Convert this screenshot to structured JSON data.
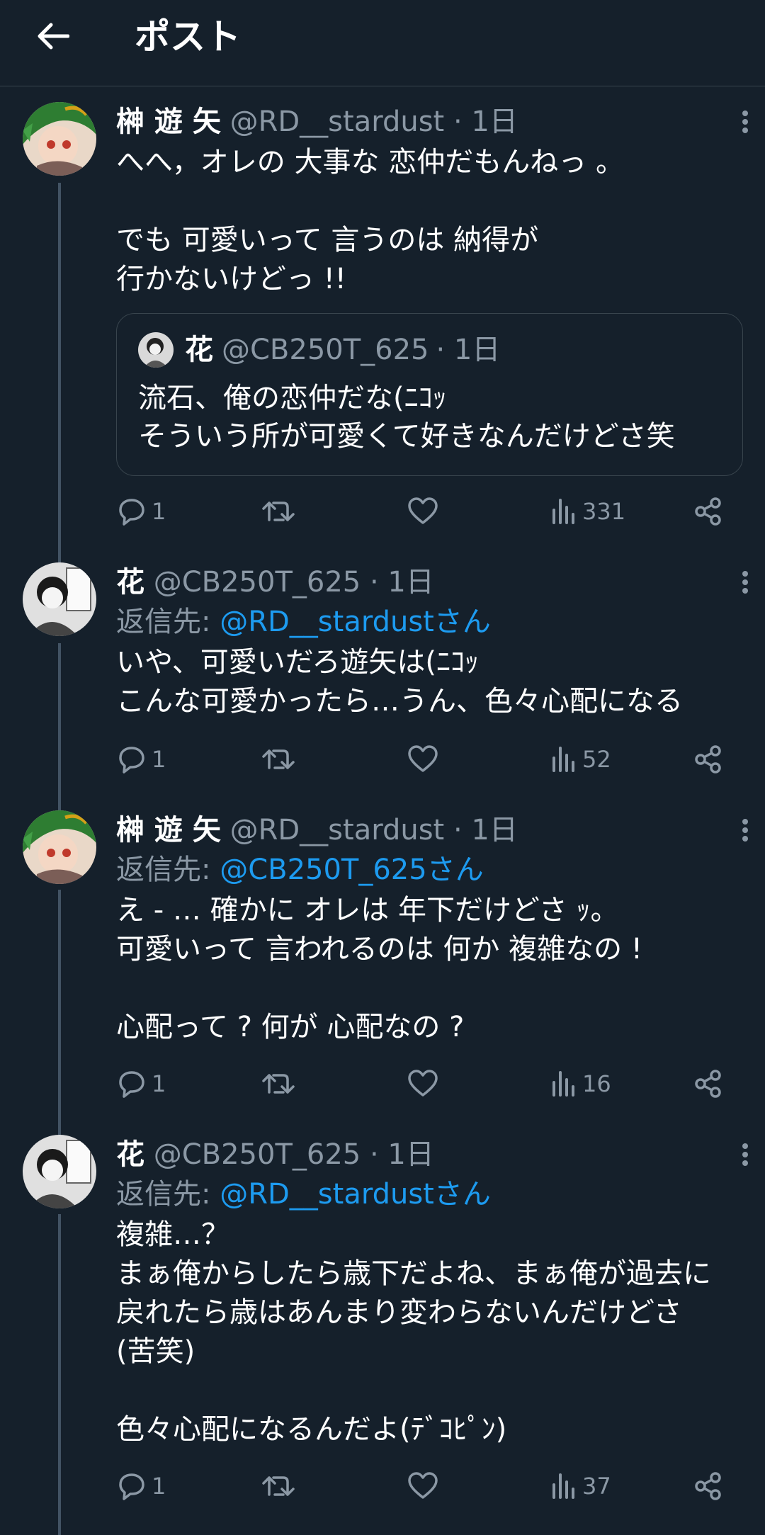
{
  "header": {
    "title": "ポスト"
  },
  "posts": [
    {
      "name": "榊 遊 矢",
      "handle": "@RD__stardust",
      "time": "· 1日",
      "reply_label": "",
      "reply_mention": "",
      "text": "へへ，オレの 大事な 恋仲だもんねっ 。\n\nでも 可愛いって 言うのは 納得が\n行かないけどっ !!",
      "quote": {
        "name": "花",
        "handle": "@CB250T_625",
        "time": "· 1日",
        "text": "流石、俺の恋仲だな(ﾆｺｯ\nそういう所が可愛くて好きなんだけどさ笑"
      },
      "stats": {
        "replies": "1",
        "views": "331"
      }
    },
    {
      "name": "花",
      "handle": "@CB250T_625",
      "time": "· 1日",
      "reply_label": "返信先: ",
      "reply_mention": "@RD__stardustさん",
      "text": "いや、可愛いだろ遊矢は(ﾆｺｯ\nこんな可愛かったら…うん、色々心配になる",
      "stats": {
        "replies": "1",
        "views": "52"
      }
    },
    {
      "name": "榊 遊 矢",
      "handle": "@RD__stardust",
      "time": "· 1日",
      "reply_label": "返信先: ",
      "reply_mention": "@CB250T_625さん",
      "text": "え - … 確かに オレは 年下だけどさ ｯ。\n可愛いって 言われるのは 何か 複雑なの !\n\n心配って ? 何が 心配なの ?",
      "stats": {
        "replies": "1",
        "views": "16"
      }
    },
    {
      "name": "花",
      "handle": "@CB250T_625",
      "time": "· 1日",
      "reply_label": "返信先: ",
      "reply_mention": "@RD__stardustさん",
      "text": "複雑…？\nまぁ俺からしたら歳下だよね、まぁ俺が過去に\n戻れたら歳はあんまり変わらないんだけどさ\n(苦笑)\n\n色々心配になるんだよ(ﾃﾞｺﾋﾟﾝ)",
      "stats": {
        "replies": "1",
        "views": "37"
      }
    }
  ],
  "icons": [
    "back-arrow-icon",
    "more-icon",
    "reply-icon",
    "retweet-icon",
    "like-icon",
    "views-icon",
    "share-icon"
  ],
  "colors": {
    "background": "#15202b",
    "muted": "#8b98a5",
    "link": "#1d9bf0",
    "divider": "#38444d"
  }
}
